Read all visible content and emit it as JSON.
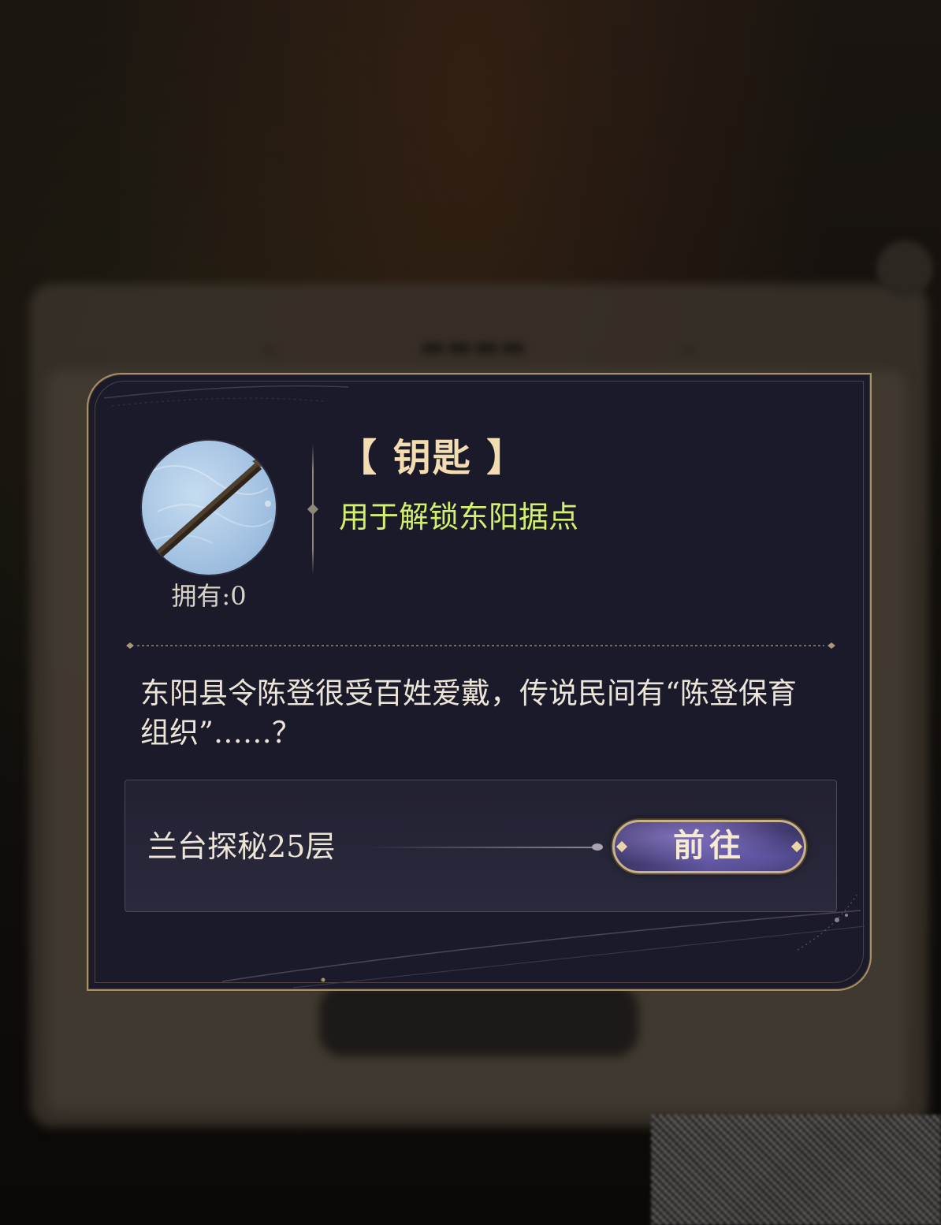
{
  "item": {
    "name": "【 钥匙 】",
    "use": "用于解锁东阳据点",
    "owned_label": "拥有:0",
    "description": "东阳县令陈登很受百姓爱戴，传说民间有“陈登保育组织”……？"
  },
  "source": {
    "label": "兰台探秘25层",
    "button_label": "前往"
  },
  "colors": {
    "dialog_bg": "#1b1a2b",
    "gold_border": "#a8906a",
    "item_name": "#f2dcb0",
    "item_use": "#d2f06c",
    "body_text": "#ece4d6"
  },
  "icons": {
    "item": "key-rod-icon",
    "divider_ornament": "diamond-ornament-icon"
  }
}
